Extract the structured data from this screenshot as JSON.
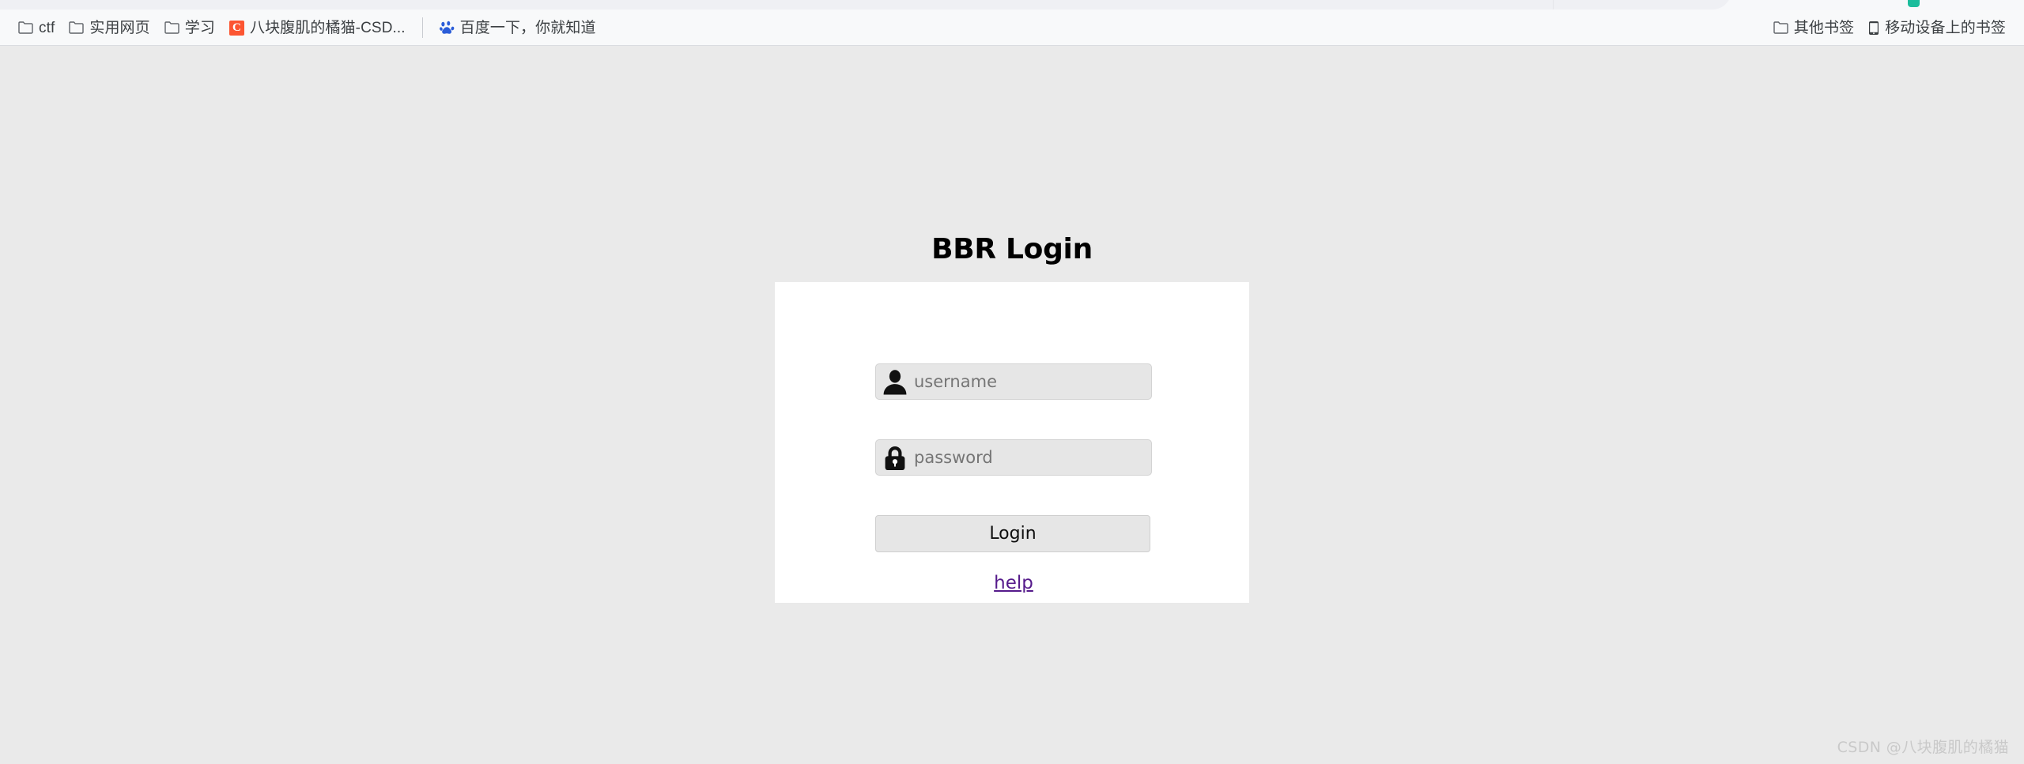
{
  "browser": {
    "bookmarks_left": [
      {
        "icon": "folder-icon",
        "label": "ctf"
      },
      {
        "icon": "folder-icon",
        "label": "实用网页"
      },
      {
        "icon": "folder-icon",
        "label": "学习"
      },
      {
        "icon": "csdn-favicon",
        "label": "八块腹肌的橘猫-CSD..."
      },
      {
        "icon": "baidu-favicon",
        "label": "百度一下，你就知道"
      }
    ],
    "bookmarks_right": [
      {
        "icon": "folder-icon",
        "label": "其他书签"
      },
      {
        "icon": "mobile-device-icon",
        "label": "移动设备上的书签"
      }
    ]
  },
  "page": {
    "title": "BBR Login",
    "background_color": "#eaeaea",
    "card_background_color": "#ffffff",
    "fields": [
      {
        "name": "username",
        "icon": "user-icon",
        "placeholder": "username",
        "value": "",
        "type": "text"
      },
      {
        "name": "password",
        "icon": "lock-icon",
        "placeholder": "password",
        "value": "",
        "type": "password"
      }
    ],
    "submit_label": "Login",
    "help_label": "help",
    "help_link_color": "#551a8b"
  },
  "watermark": {
    "text": "CSDN @八块腹肌的橘猫"
  }
}
